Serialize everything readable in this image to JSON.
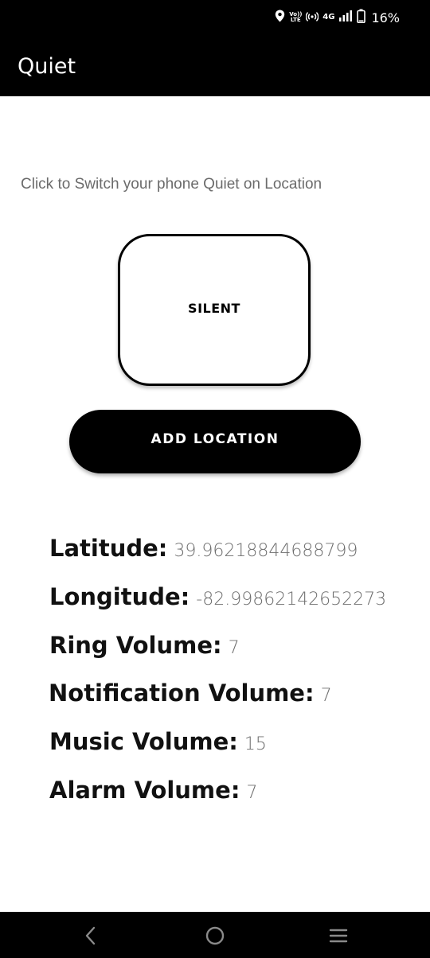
{
  "status_bar": {
    "volte_label": "Vo)) LTE",
    "network_label": "4G",
    "battery_percent": "16%",
    "icons": [
      "location-icon",
      "volte-icon",
      "hotspot-icon",
      "signal-icon",
      "battery-icon"
    ]
  },
  "app_bar": {
    "title": "Quiet"
  },
  "main": {
    "prompt": "Click to Switch your phone Quiet on Location",
    "silent_button_label": "SILENT",
    "add_location_label": "ADD LOCATION"
  },
  "info": {
    "latitude_label": "Latitude:",
    "latitude_value": "39.96218844688799",
    "longitude_label": "Longitude:",
    "longitude_value": "-82.99862142652273",
    "ring_label": "Ring Volume:",
    "ring_value": "7",
    "notification_label": "Notification Volume:",
    "notification_value": "7",
    "music_label": "Music Volume:",
    "music_value": "15",
    "alarm_label": "Alarm Volume:",
    "alarm_value": "7"
  },
  "nav_bar": {
    "icons": [
      "back-icon",
      "home-icon",
      "recents-icon"
    ]
  },
  "colors": {
    "bar_background": "#000000",
    "page_background": "#ffffff",
    "prompt_text": "#6b6b6b",
    "value_text": "#6e6e6e"
  }
}
